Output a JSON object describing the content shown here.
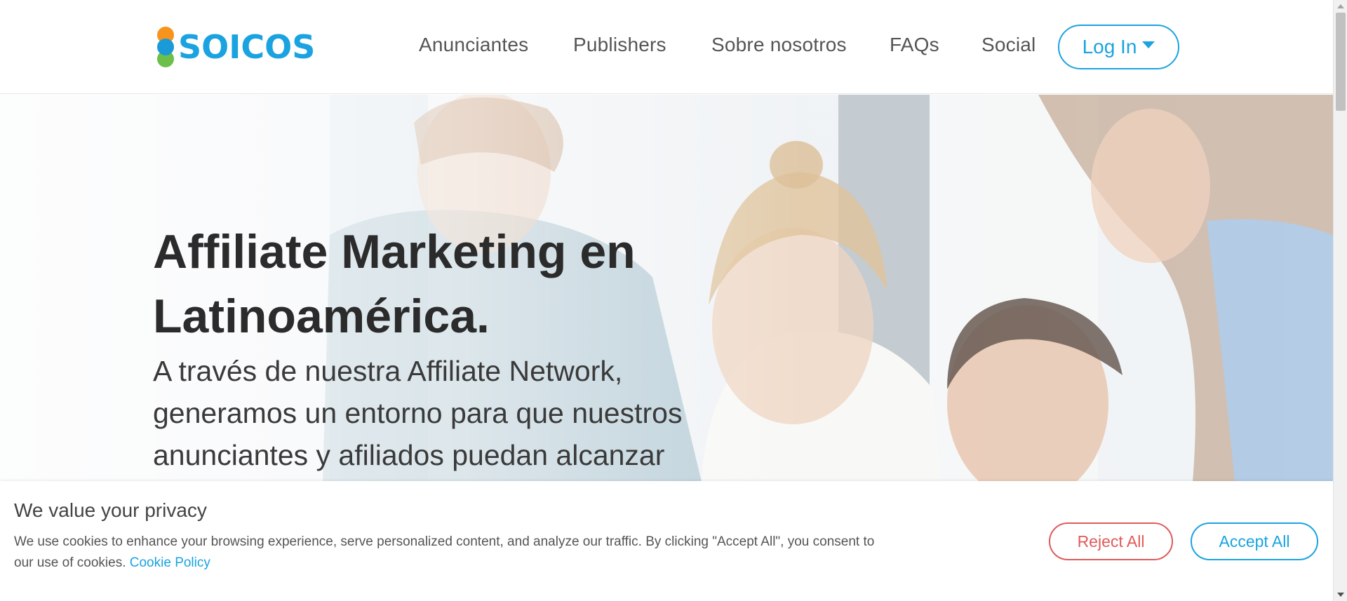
{
  "brand": {
    "name": "SOICOS",
    "colors": {
      "primary": "#1aa3e0",
      "orange": "#f7941d",
      "green": "#6cc04a",
      "reject": "#e05a5a"
    }
  },
  "nav": {
    "items": [
      {
        "label": "Anunciantes"
      },
      {
        "label": "Publishers"
      },
      {
        "label": "Sobre nosotros"
      },
      {
        "label": "FAQs"
      },
      {
        "label": "Social"
      }
    ],
    "login_label": "Log In"
  },
  "hero": {
    "title": "Affiliate Marketing en Latinoamérica.",
    "subtitle": "A través de nuestra Affiliate Network, generamos un entorno para que nuestros anunciantes y afiliados puedan alcanzar"
  },
  "cookie_banner": {
    "title": "We value your privacy",
    "text": "We use cookies to enhance your browsing experience, serve personalized content, and analyze our traffic. By clicking \"Accept All\", you consent to our use of cookies.",
    "link_label": "Cookie Policy",
    "reject_label": "Reject All",
    "accept_label": "Accept All"
  },
  "icons": [
    "caret-down-icon",
    "scroll-up-icon",
    "scroll-down-icon"
  ]
}
